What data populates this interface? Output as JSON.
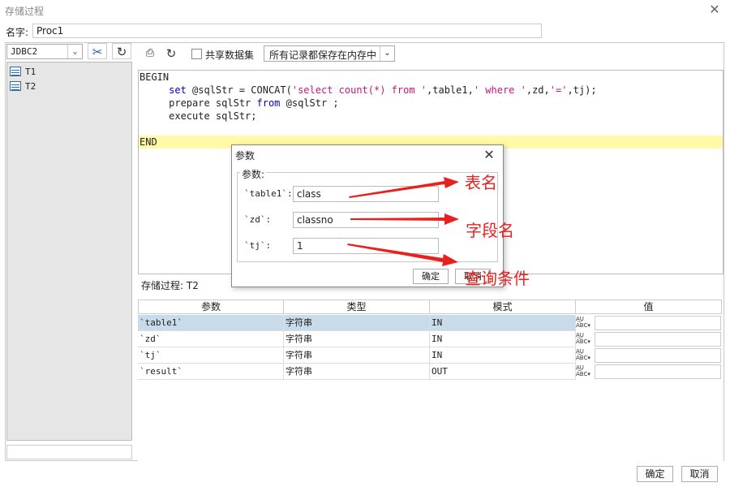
{
  "window": {
    "title": "存储过程"
  },
  "name_row": {
    "label": "名字:",
    "value": "Proc1"
  },
  "left": {
    "datasource": "JDBC2",
    "tables": [
      "T1",
      "T2"
    ]
  },
  "toolbar": {
    "share_label": "共享数据集",
    "mode_value": "所有记录都保存在内存中"
  },
  "editor": {
    "begin": "BEGIN",
    "line1_kw": "set",
    "line1_a": " @sqlStr = CONCAT(",
    "line1_s1": "'select count(*) from '",
    "line1_b": ",table1,",
    "line1_s2": "' where '",
    "line1_c": ",zd,",
    "line1_s3": "'='",
    "line1_d": ",tj);",
    "line2_a": "prepare sqlStr ",
    "line2_kw": "from",
    "line2_b": " @sqlStr ;",
    "line3": "execute sqlStr;",
    "end": "END"
  },
  "proc": {
    "label": "存储过程: T2"
  },
  "param_table": {
    "headers": [
      "参数",
      "类型",
      "模式",
      "值"
    ],
    "rows": [
      {
        "name": "`table1`",
        "type": "字符串",
        "mode": "IN",
        "selected": true
      },
      {
        "name": "`zd`",
        "type": "字符串",
        "mode": "IN",
        "selected": false
      },
      {
        "name": "`tj`",
        "type": "字符串",
        "mode": "IN",
        "selected": false
      },
      {
        "name": "`result`",
        "type": "字符串",
        "mode": "OUT",
        "selected": false
      }
    ]
  },
  "buttons": {
    "ok": "确定",
    "cancel": "取消"
  },
  "dialog": {
    "title": "参数",
    "group_label": "参数:",
    "params": [
      {
        "label": "`table1`:",
        "value": "class"
      },
      {
        "label": "`zd`:",
        "value": "classno"
      },
      {
        "label": "`tj`:",
        "value": "1"
      }
    ],
    "ok": "确定",
    "cancel": "取消"
  },
  "annotations": {
    "note1": "表名",
    "note2": "字段名",
    "note3": "查询条件",
    "color": "#e8211f"
  },
  "icons": [
    "close-icon",
    "tools-icon",
    "refresh-icon",
    "preview-icon",
    "table-icon",
    "abc-icon",
    "chevron-down-icon"
  ]
}
